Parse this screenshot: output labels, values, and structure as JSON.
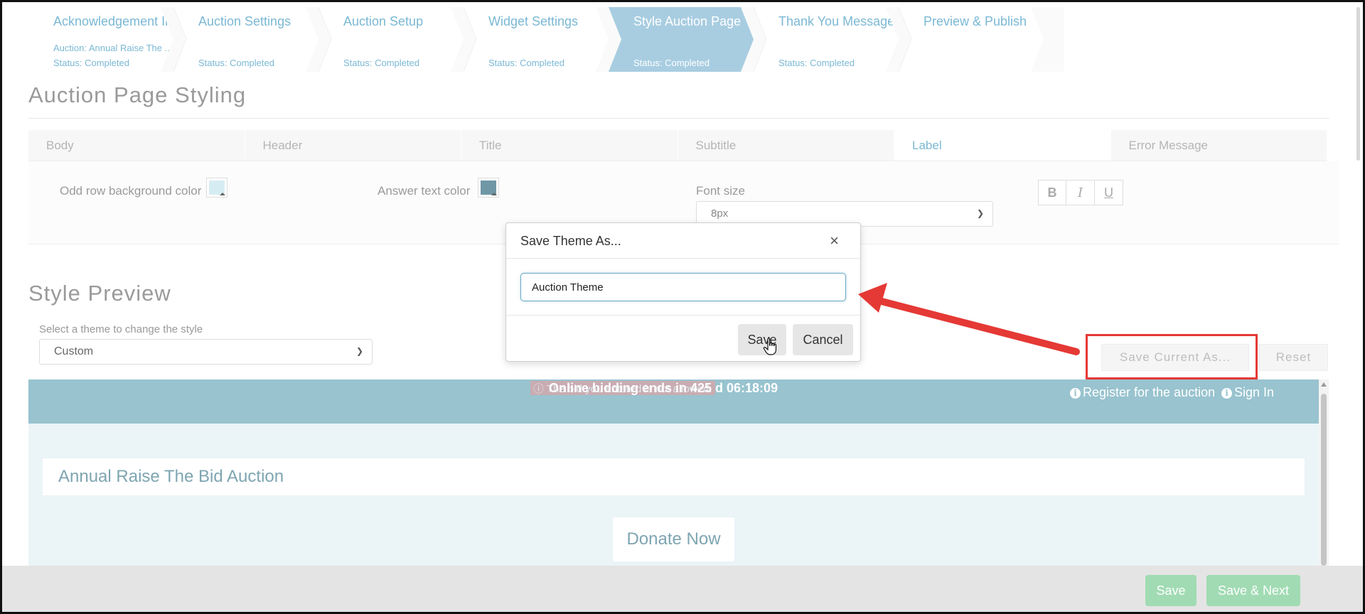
{
  "wizard": {
    "steps": [
      {
        "title": "Acknowledgement Info",
        "sub": "Auction: Annual Raise The ...",
        "status": "Status: Completed"
      },
      {
        "title": "Auction Settings",
        "sub": "",
        "status": "Status: Completed"
      },
      {
        "title": "Auction Setup",
        "sub": "",
        "status": "Status: Completed"
      },
      {
        "title": "Widget Settings",
        "sub": "",
        "status": "Status: Completed"
      },
      {
        "title": "Style Auction Page",
        "sub": "",
        "status": "Status: Completed"
      },
      {
        "title": "Thank You Message",
        "sub": "",
        "status": "Status: Completed"
      },
      {
        "title": "Preview & Publish",
        "sub": "",
        "status": ""
      }
    ],
    "active_index": 4
  },
  "styling": {
    "heading": "Auction Page Styling",
    "tabs": [
      "Body",
      "Header",
      "Title",
      "Subtitle",
      "Label",
      "Error Message"
    ],
    "active_tab": "Label",
    "odd_row_label": "Odd row background color",
    "odd_row_color": "#d6ecf3",
    "answer_text_label": "Answer text color",
    "answer_text_color": "#6f97a6",
    "font_size_label": "Font size",
    "font_size_value": "8px",
    "format_buttons": [
      "B",
      "I",
      "U"
    ]
  },
  "preview": {
    "heading": "Style Preview",
    "theme_label": "Select a theme to change the style",
    "theme_value": "Custom",
    "save_current_as": "Save Current As...",
    "reset": "Reset",
    "error_note": "The bid you entered is not allowed.",
    "timer_text": "Online bidding ends in 425 d 06:18:09",
    "register_link": "Register for the auction",
    "sign_in_link": "Sign In",
    "auction_title": "Annual Raise The Bid Auction",
    "donate_label": "Donate Now"
  },
  "footer": {
    "save": "Save",
    "save_next": "Save & Next"
  },
  "modal": {
    "title": "Save Theme As...",
    "close_glyph": "×",
    "input_value": "Auction Theme",
    "save": "Save",
    "cancel": "Cancel"
  },
  "colors": {
    "accent": "#7bb8d4",
    "active_step": "#a8cde1",
    "preview_bar": "#98c3cf",
    "green_button": "#a1dbb3",
    "annotation_red": "#e53935"
  }
}
